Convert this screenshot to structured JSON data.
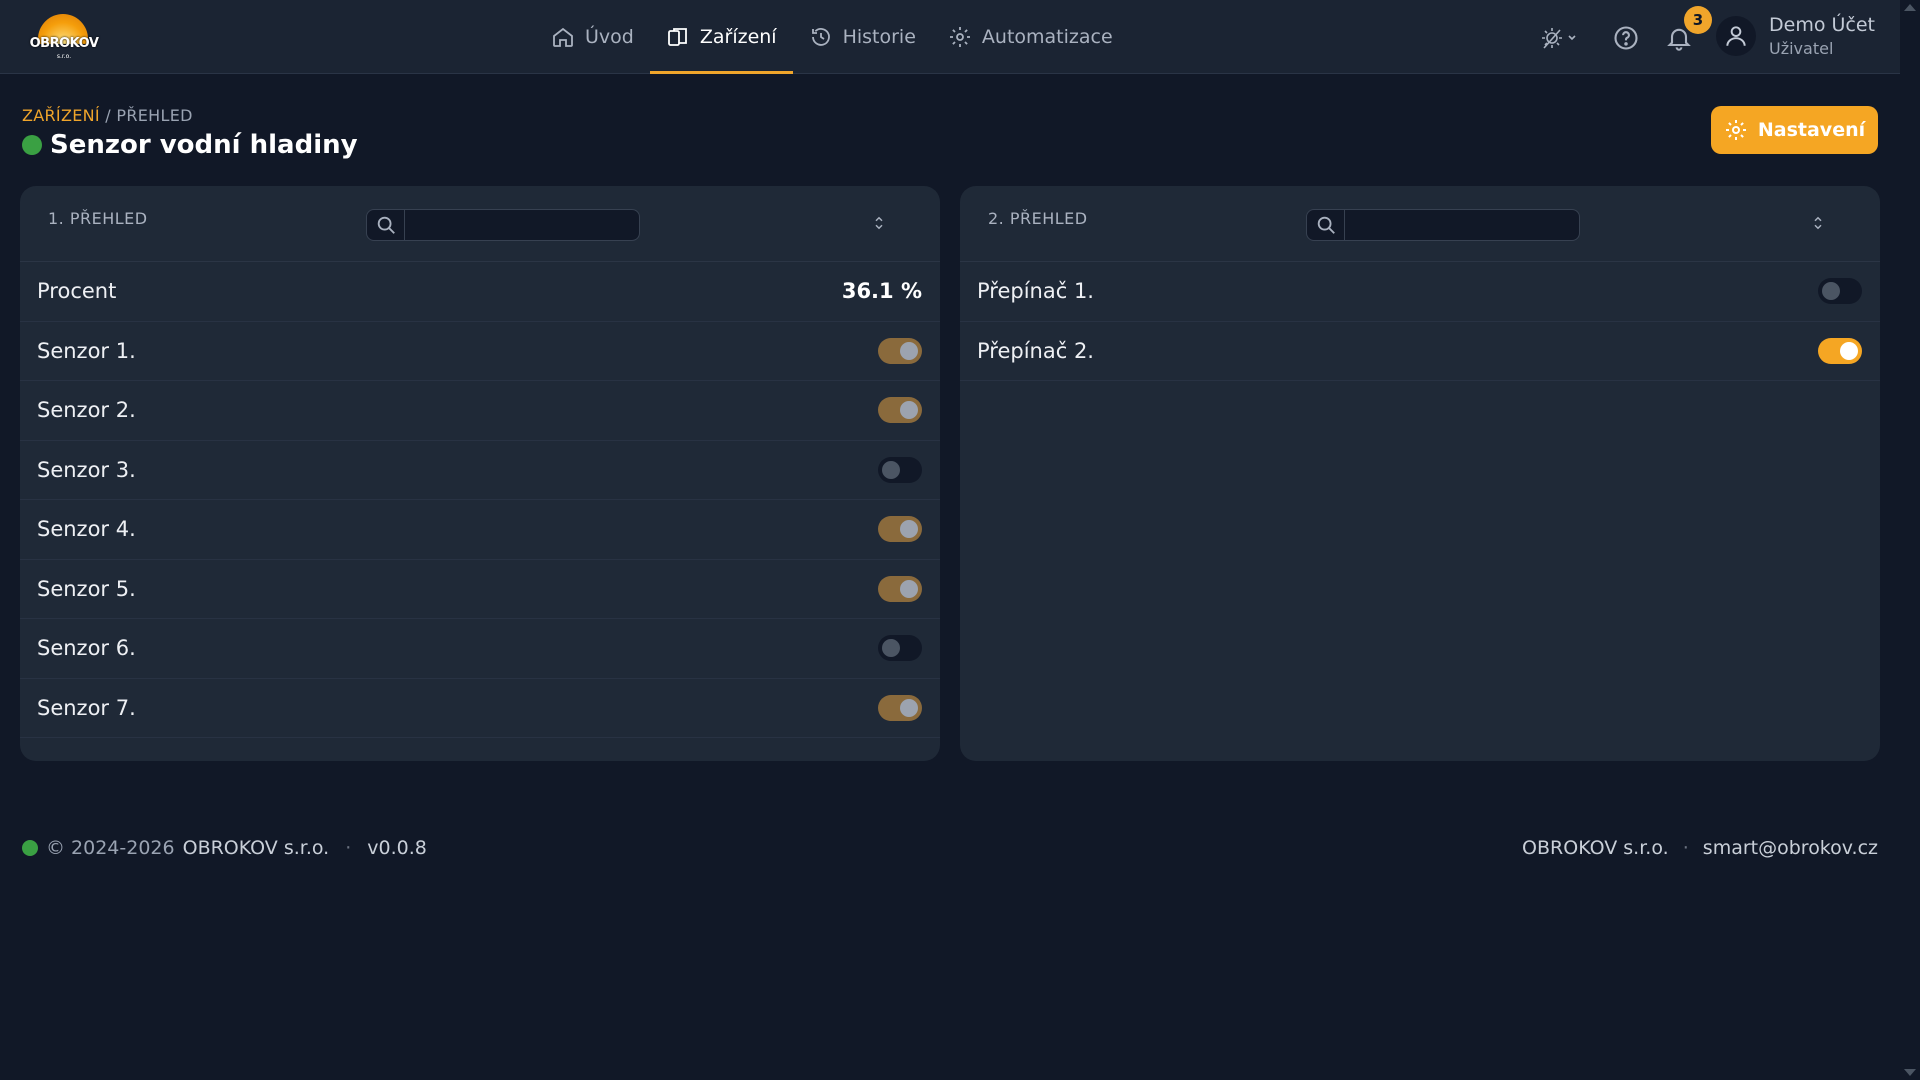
{
  "brand": {
    "logo_text": "OBROKOV",
    "logo_sub": "s.r.o."
  },
  "nav": {
    "items": [
      {
        "label": "Úvod",
        "icon": "home-icon",
        "active": false
      },
      {
        "label": "Zařízení",
        "icon": "devices-icon",
        "active": true
      },
      {
        "label": "Historie",
        "icon": "history-icon",
        "active": false
      },
      {
        "label": "Automatizace",
        "icon": "gear-icon",
        "active": false
      }
    ]
  },
  "header_tools": {
    "notifications_count": "3",
    "user_name": "Demo Účet",
    "user_role": "Uživatel"
  },
  "breadcrumb": {
    "section": "ZAŘÍZENÍ",
    "separator": "/",
    "page": "PŘEHLED"
  },
  "page": {
    "title": "Senzor vodní hladiny",
    "status_color": "#3aa043",
    "settings_label": "Nastavení"
  },
  "panels": {
    "left": {
      "title": "1. PŘEHLED",
      "search_value": "",
      "rows": [
        {
          "label": "Procent",
          "value": "36.1 %"
        },
        {
          "label": "Senzor 1.",
          "state": true
        },
        {
          "label": "Senzor 2.",
          "state": true
        },
        {
          "label": "Senzor 3.",
          "state": false
        },
        {
          "label": "Senzor 4.",
          "state": true
        },
        {
          "label": "Senzor 5.",
          "state": true
        },
        {
          "label": "Senzor 6.",
          "state": false
        },
        {
          "label": "Senzor 7.",
          "state": true
        }
      ]
    },
    "right": {
      "title": "2. PŘEHLED",
      "search_value": "",
      "rows": [
        {
          "label": "Přepínač 1.",
          "state": false
        },
        {
          "label": "Přepínač 2.",
          "state": true
        }
      ]
    }
  },
  "footer": {
    "copyright": "© 2024-2026",
    "company": "OBROKOV s.r.o.",
    "separator": "·",
    "version": "v0.0.8",
    "right_company": "OBROKOV s.r.o.",
    "email": "smart@obrokov.cz"
  },
  "colors": {
    "accent": "#f5a623",
    "background": "#111827",
    "panel": "#1f2937",
    "status_ok": "#3aa043"
  }
}
